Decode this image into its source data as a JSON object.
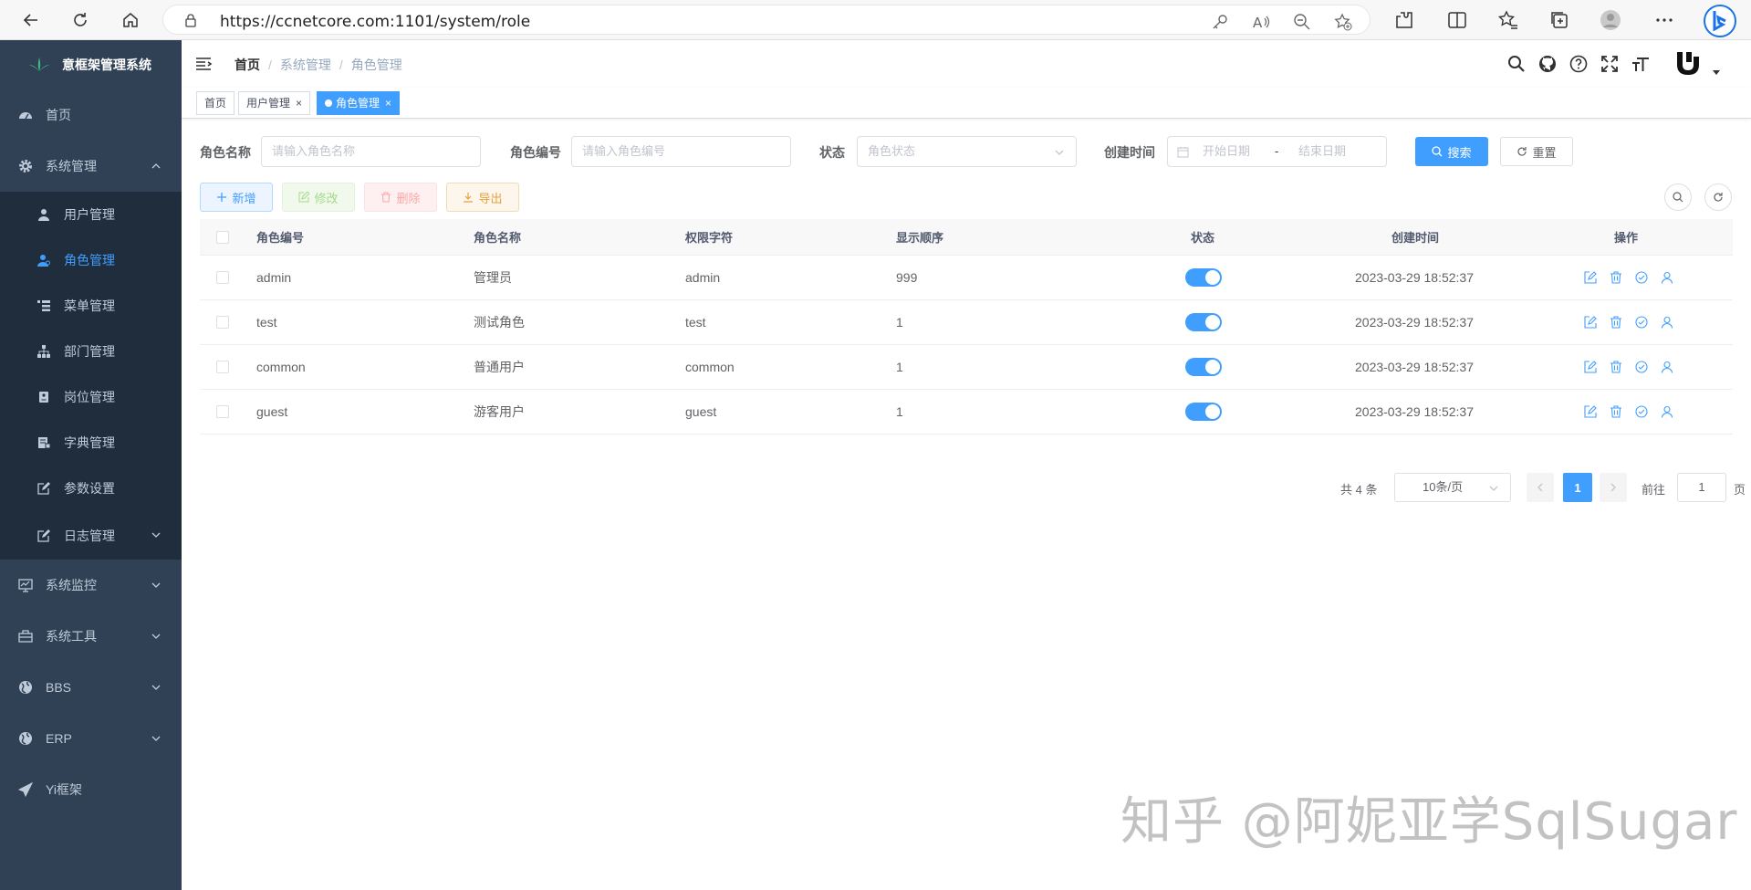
{
  "browser": {
    "url": "https://ccnetcore.com:1101/system/role"
  },
  "sidebar": {
    "title": "意框架管理系统",
    "items": [
      {
        "label": "首页",
        "icon": "dashboard-icon"
      },
      {
        "label": "系统管理",
        "icon": "gear-icon",
        "expanded": true
      },
      {
        "label": "系统监控",
        "icon": "monitor-icon"
      },
      {
        "label": "系统工具",
        "icon": "toolbox-icon"
      },
      {
        "label": "BBS",
        "icon": "globe-icon"
      },
      {
        "label": "ERP",
        "icon": "globe-icon"
      },
      {
        "label": "Yi框架",
        "icon": "paper-plane-icon"
      }
    ],
    "sub_items": [
      {
        "label": "用户管理",
        "icon": "user-icon"
      },
      {
        "label": "角色管理",
        "icon": "role-icon",
        "active": true
      },
      {
        "label": "菜单管理",
        "icon": "tree-table-icon"
      },
      {
        "label": "部门管理",
        "icon": "org-tree-icon"
      },
      {
        "label": "岗位管理",
        "icon": "post-icon"
      },
      {
        "label": "字典管理",
        "icon": "dict-icon"
      },
      {
        "label": "参数设置",
        "icon": "edit-icon"
      },
      {
        "label": "日志管理",
        "icon": "log-icon"
      }
    ]
  },
  "navbar": {
    "breadcrumb": [
      "首页",
      "系统管理",
      "角色管理"
    ]
  },
  "tags": [
    {
      "label": "首页"
    },
    {
      "label": "用户管理",
      "close": "×"
    },
    {
      "label": "角色管理",
      "close": "×",
      "active": true
    }
  ],
  "query": {
    "role_name_label": "角色名称",
    "role_name_placeholder": "请输入角色名称",
    "role_code_label": "角色编号",
    "role_code_placeholder": "请输入角色编号",
    "status_label": "状态",
    "status_placeholder": "角色状态",
    "created_label": "创建时间",
    "start_placeholder": "开始日期",
    "date_sep": "-",
    "end_placeholder": "结束日期",
    "search_label": "搜索",
    "reset_label": "重置"
  },
  "toolbar": {
    "add_label": "新增",
    "edit_label": "修改",
    "delete_label": "删除",
    "export_label": "导出"
  },
  "table": {
    "headers": [
      "角色编号",
      "角色名称",
      "权限字符",
      "显示顺序",
      "状态",
      "创建时间",
      "操作"
    ],
    "rows": [
      {
        "code": "admin",
        "name": "管理员",
        "perm": "admin",
        "order": "999",
        "enabled": true,
        "created": "2023-03-29 18:52:37"
      },
      {
        "code": "test",
        "name": "测试角色",
        "perm": "test",
        "order": "1",
        "enabled": true,
        "created": "2023-03-29 18:52:37"
      },
      {
        "code": "common",
        "name": "普通用户",
        "perm": "common",
        "order": "1",
        "enabled": true,
        "created": "2023-03-29 18:52:37"
      },
      {
        "code": "guest",
        "name": "游客用户",
        "perm": "guest",
        "order": "1",
        "enabled": true,
        "created": "2023-03-29 18:52:37"
      }
    ]
  },
  "pagination": {
    "total": "共 4 条",
    "page_size": "10条/页",
    "current_page": "1",
    "goto_label": "前往",
    "goto_value": "1",
    "page_suffix": "页"
  },
  "watermark": "知乎 @阿妮亚学SqlSugar",
  "colors": {
    "sidebar_bg": "#304156",
    "submenu_bg": "#1f2d3d",
    "primary": "#409eff",
    "success": "#67c23a",
    "danger": "#f56c6c",
    "warning": "#e6a23c"
  }
}
